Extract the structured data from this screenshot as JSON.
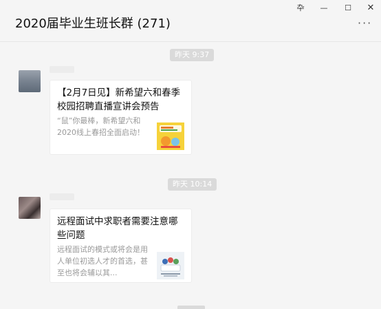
{
  "window": {
    "title": "2020届毕业生班长群 (271)",
    "controls": {
      "pin": "卆",
      "minimize": "—",
      "maximize": "☐",
      "close": "✕"
    },
    "more": "···"
  },
  "messages": [
    {
      "timestamp": "昨天 9:37",
      "card": {
        "title": "【2月7日见】新希望六和春季校园招聘直播宣讲会预告",
        "description": "“鼠”你最棒，新希望六和2020线上春招全面启动！",
        "thumbnail_icon": "yellow-poster-thumbnail"
      }
    },
    {
      "timestamp": "昨天 10:14",
      "card": {
        "title": "远程面试中求职者需要注意哪些问题",
        "description": "远程面试的模式或将会是用人单位初选人才的首选，甚至也将会辅以其...",
        "thumbnail_icon": "interview-illustration-thumbnail"
      }
    }
  ],
  "colors": {
    "background": "#f5f5f5",
    "timestamp_bg": "#dadada",
    "card_bg": "#ffffff",
    "description_text": "#9a9a9a"
  }
}
